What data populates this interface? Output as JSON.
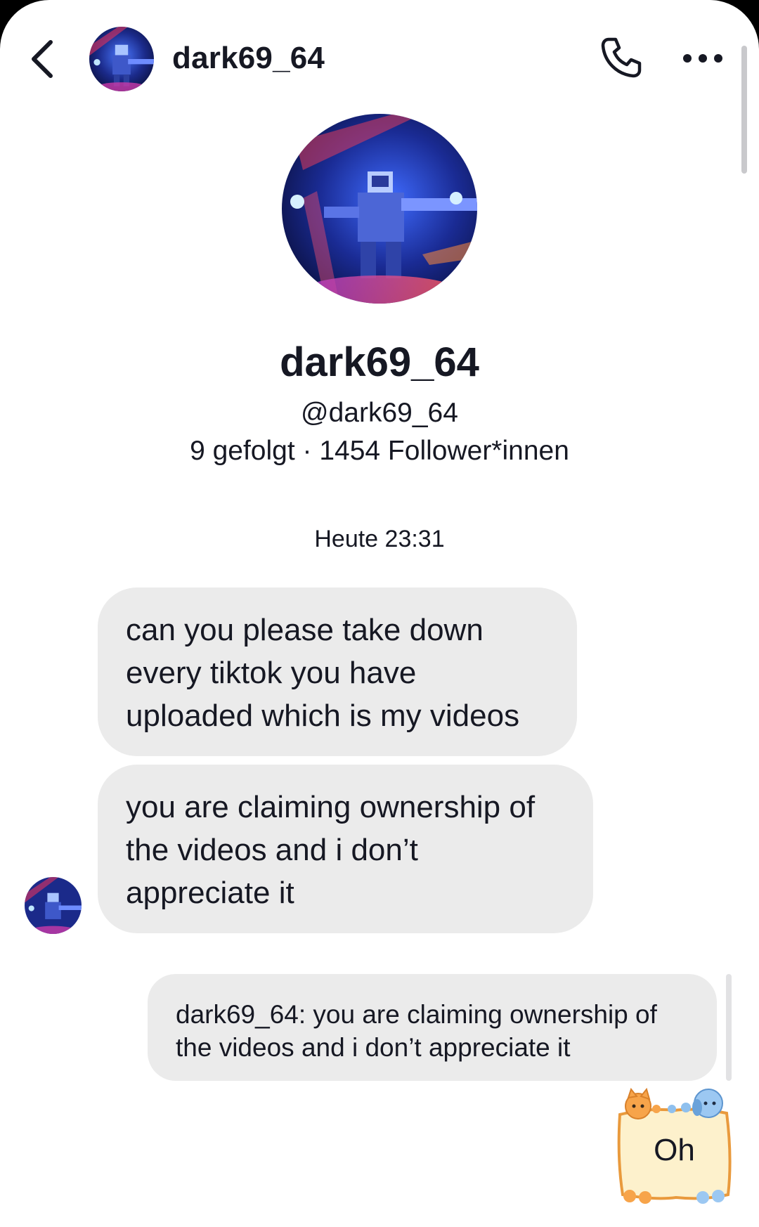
{
  "header": {
    "back_icon": "chevron-left-icon",
    "username": "dark69_64",
    "call_icon": "phone-icon",
    "more_icon": "more-horizontal-icon"
  },
  "profile": {
    "display_name": "dark69_64",
    "handle": "@dark69_64",
    "stats": "9 gefolgt · 1454 Follower*innen"
  },
  "chat": {
    "timestamp": "Heute 23:31",
    "messages": [
      {
        "sender": "dark69_64",
        "lines": [
          "can you please take down",
          "every tiktok you have",
          "uploaded which is my videos"
        ]
      },
      {
        "sender": "dark69_64",
        "lines": [
          "you are claiming ownership of",
          "the videos and i don’t",
          "appreciate it"
        ]
      }
    ],
    "reply": {
      "lines": [
        "dark69_64: you are claiming ownership of",
        "the videos and i don’t appreciate it"
      ]
    },
    "sticker": {
      "text": "Oh",
      "icon": "cat-dog-sign-sticker"
    }
  },
  "colors": {
    "background": "#ffffff",
    "bubble": "#ebebeb",
    "text": "#161823",
    "avatar_primary": "#2b3fb8",
    "avatar_accent": "#e0367a"
  }
}
